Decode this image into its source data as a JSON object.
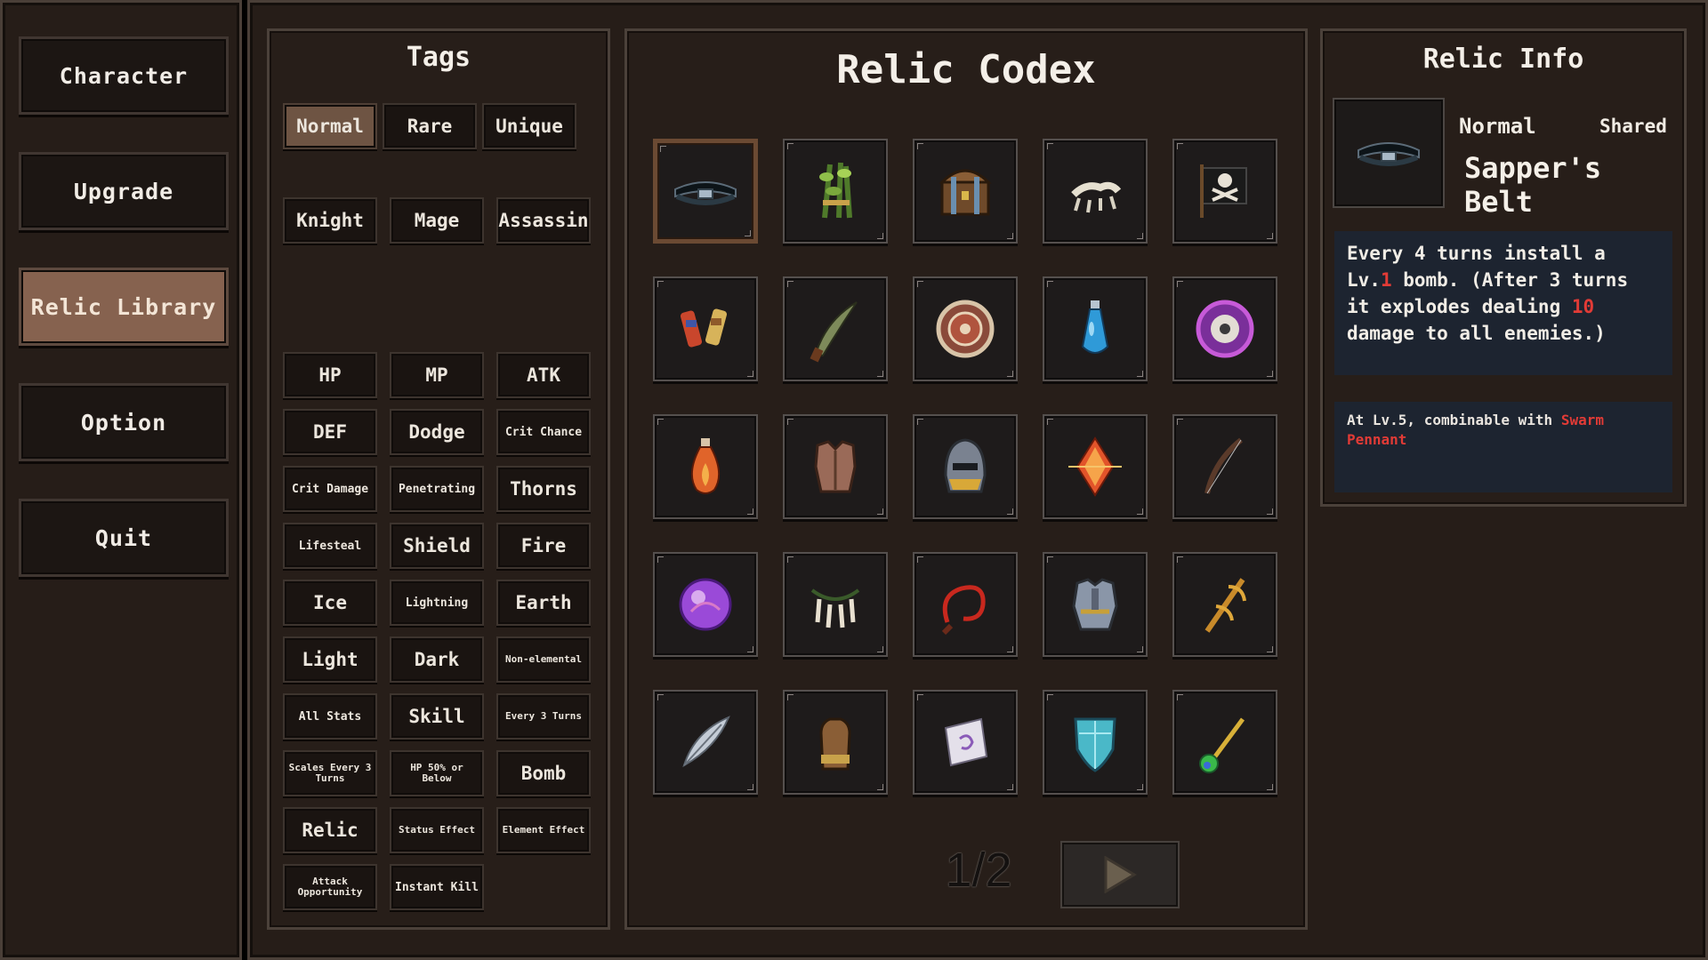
{
  "menu": {
    "items": [
      {
        "label": "Character",
        "active": false
      },
      {
        "label": "Upgrade",
        "active": false
      },
      {
        "label": "Relic Library",
        "active": true
      },
      {
        "label": "Option",
        "active": false
      },
      {
        "label": "Quit",
        "active": false
      }
    ]
  },
  "tags": {
    "title": "Tags",
    "rarity": [
      "Normal",
      "Rare",
      "Unique"
    ],
    "classes": [
      "Knight",
      "Mage",
      "Assassin"
    ],
    "attributes": [
      "HP",
      "MP",
      "ATK",
      "DEF",
      "Dodge",
      "Crit Chance",
      "Crit Damage",
      "Penetrating",
      "Thorns",
      "Lifesteal",
      "Shield",
      "Fire",
      "Ice",
      "Lightning",
      "Earth",
      "Light",
      "Dark",
      "Non-elemental",
      "All Stats",
      "Skill",
      "Every 3 Turns",
      "Scales Every 3 Turns",
      "HP 50% or Below",
      "Bomb",
      "Relic",
      "Status Effect",
      "Element Effect",
      "Attack Opportunity",
      "Instant Kill"
    ],
    "active": "Normal"
  },
  "codex": {
    "title": "Relic Codex",
    "page": "1/2",
    "selected_index": 0,
    "relics": [
      "belt-icon",
      "herb-bundle-icon",
      "treasure-chest-icon",
      "bone-claws-icon",
      "pirate-flag-icon",
      "dumbbell-scrolls-icon",
      "curved-blade-icon",
      "round-shield-icon",
      "blue-potion-icon",
      "purple-eye-orb-icon",
      "fire-potion-icon",
      "leather-armor-icon",
      "knight-helmet-icon",
      "fire-crystal-icon",
      "dark-bow-icon",
      "purple-orb-icon",
      "talon-necklace-icon",
      "red-whip-icon",
      "steel-armor-icon",
      "golden-staff-icon",
      "silver-feather-icon",
      "leather-glove-icon",
      "magic-scroll-icon",
      "crystal-shield-icon",
      "gem-wand-icon"
    ]
  },
  "info": {
    "title": "Relic Info",
    "rarity": "Normal",
    "shared": "Shared",
    "name": "Sapper's Belt",
    "description": {
      "part1": "Every 4 turns install a Lv.",
      "level": "1",
      "part2": " bomb. (After 3 turns it explodes dealing ",
      "damage": "10",
      "part3": " damage to all enemies.)"
    },
    "combo": {
      "prefix": "At Lv.5, combinable with ",
      "relic": "Swarm Pennant"
    }
  },
  "colors": {
    "accent_active": "#86624f",
    "highlight_red": "#e23b36",
    "panel_bg": "#271e19",
    "desc_bg": "#1d2430"
  }
}
